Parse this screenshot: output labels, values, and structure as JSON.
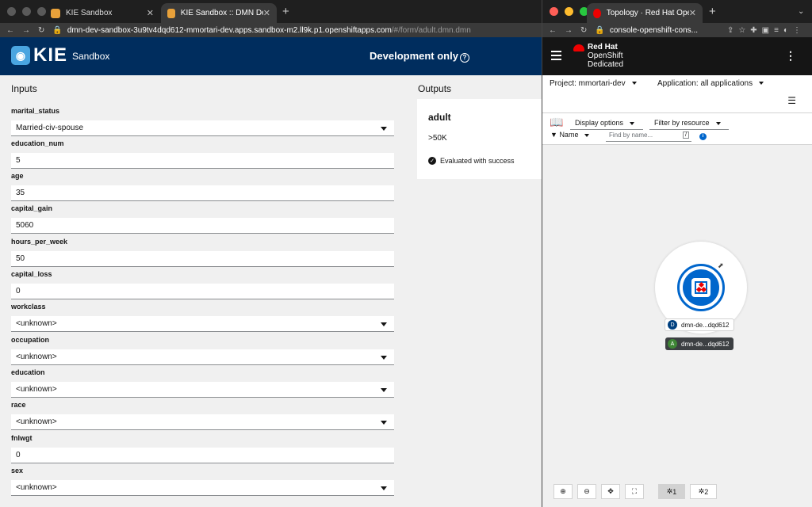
{
  "left_browser": {
    "tabs": [
      {
        "title": "KIE Sandbox"
      },
      {
        "title": "KIE Sandbox :: DMN Developer"
      }
    ],
    "url_host": "dmn-dev-sandbox-3u9tv4dqd612-mmortari-dev.apps.sandbox-m2.ll9k.p1.openshiftapps.com",
    "url_path": "/#/form/adult.dmn.dmn"
  },
  "kie_header": {
    "logo_text": "KIE",
    "subtitle": "Sandbox",
    "dev_only": "Development only"
  },
  "inputs": {
    "title": "Inputs",
    "fields": [
      {
        "label": "marital_status",
        "value": "Married-civ-spouse",
        "type": "select"
      },
      {
        "label": "education_num",
        "value": "5",
        "type": "text"
      },
      {
        "label": "age",
        "value": "35",
        "type": "text"
      },
      {
        "label": "capital_gain",
        "value": "5060",
        "type": "text"
      },
      {
        "label": "hours_per_week",
        "value": "50",
        "type": "text"
      },
      {
        "label": "capital_loss",
        "value": "0",
        "type": "text"
      },
      {
        "label": "workclass",
        "value": "<unknown>",
        "type": "select"
      },
      {
        "label": "occupation",
        "value": "<unknown>",
        "type": "select"
      },
      {
        "label": "education",
        "value": "<unknown>",
        "type": "select"
      },
      {
        "label": "race",
        "value": "<unknown>",
        "type": "select"
      },
      {
        "label": "fnlwgt",
        "value": "0",
        "type": "text"
      },
      {
        "label": "sex",
        "value": "<unknown>",
        "type": "select"
      }
    ]
  },
  "outputs": {
    "title": "Outputs",
    "name": "adult",
    "value": ">50K",
    "status": "Evaluated with success"
  },
  "right_browser": {
    "tab_title": "Topology · Red Hat OpenShift",
    "url": "console-openshift-cons..."
  },
  "openshift": {
    "brand": "Red Hat",
    "product": "OpenShift",
    "edition": "Dedicated",
    "project_label": "Project: mmortari-dev",
    "application_label": "Application: all applications",
    "display_options": "Display options",
    "filter_by_resource": "Filter by resource",
    "name_filter": "Name",
    "find_placeholder": "Find by name...",
    "find_shortcut": "/",
    "node_deployment_badge": "D",
    "node_deployment_label": "dmn-de...dqd612",
    "node_app_badge": "A",
    "node_app_label": "dmn-de...dqd612",
    "zoom_controls": {
      "layout1": "1",
      "layout2": "2"
    }
  }
}
